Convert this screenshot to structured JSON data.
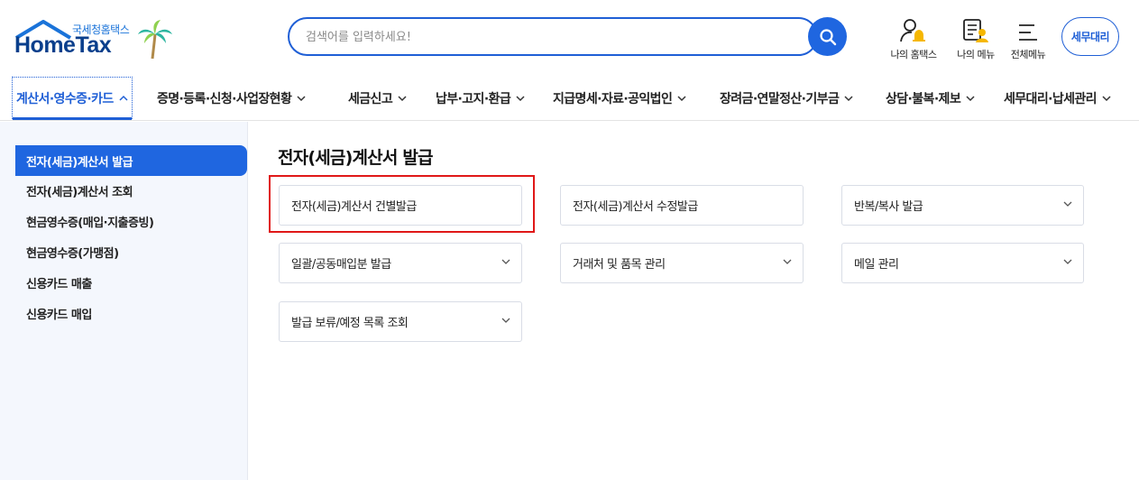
{
  "header": {
    "logo_sub": "국세청홈택스",
    "logo_main": "HomeTax",
    "search_placeholder": "검색어를 입력하세요!",
    "utilities": [
      {
        "label": "나의 홈택스",
        "icon": "user-bell-icon"
      },
      {
        "label": "나의 메뉴",
        "icon": "document-user-icon"
      },
      {
        "label": "전체메뉴",
        "icon": "hamburger-menu-icon"
      }
    ],
    "tax_agent_label": "세무대리"
  },
  "nav": [
    {
      "label": "계산서·영수증·카드",
      "active": true
    },
    {
      "label": "증명·등록·신청·사업장현황"
    },
    {
      "label": "세금신고"
    },
    {
      "label": "납부·고지·환급"
    },
    {
      "label": "지급명세·자료·공익법인"
    },
    {
      "label": "장려금·연말정산·기부금"
    },
    {
      "label": "상담·불복·제보"
    },
    {
      "label": "세무대리·납세관리"
    }
  ],
  "sidebar": {
    "items": [
      {
        "label": "전자(세금)계산서 발급",
        "active": true
      },
      {
        "label": "전자(세금)계산서 조회"
      },
      {
        "label": "현금영수증(매입·지출증빙)"
      },
      {
        "label": "현금영수증(가맹점)"
      },
      {
        "label": "신용카드 매출"
      },
      {
        "label": "신용카드 매입"
      }
    ]
  },
  "main": {
    "title": "전자(세금)계산서 발급",
    "cards": [
      {
        "label": "전자(세금)계산서 건별발급",
        "has_dropdown": false,
        "highlighted": true
      },
      {
        "label": "전자(세금)계산서 수정발급",
        "has_dropdown": false
      },
      {
        "label": "반복/복사 발급",
        "has_dropdown": true
      },
      {
        "label": "일괄/공동매입분 발급",
        "has_dropdown": true
      },
      {
        "label": "거래처 및 품목 관리",
        "has_dropdown": true
      },
      {
        "label": "메일 관리",
        "has_dropdown": true
      },
      {
        "label": "발급 보류/예정 목록 조회",
        "has_dropdown": true
      }
    ]
  },
  "colors": {
    "accent": "#1f66e0",
    "brand_dark": "#0a3f8c",
    "highlight": "#e01818"
  }
}
